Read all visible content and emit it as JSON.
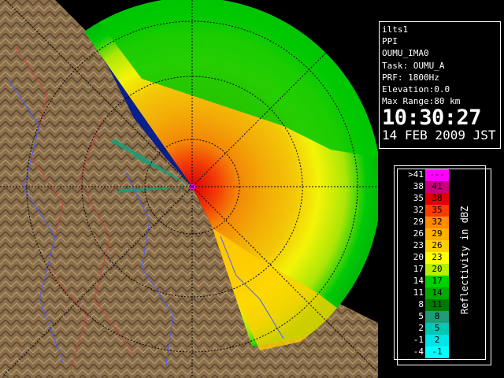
{
  "info": {
    "station": "ilts1",
    "scan_type": "PPI",
    "site": "OUMU_IMA0",
    "task": "Task: OUMU_A",
    "prf": "PRF: 1800Hz",
    "elevation": "Elevation:0.0",
    "max_range": "Max Range:80 km",
    "time": "10:30:27",
    "date": "14 FEB 2009 JST"
  },
  "legend": {
    "title": "Reflectivity in dBZ",
    "rows": [
      {
        "lo": ">41",
        "hi": "---",
        "color": "#ff00ff"
      },
      {
        "lo": "38",
        "hi": "41",
        "color": "#c8007a"
      },
      {
        "lo": "35",
        "hi": "38",
        "color": "#e00000"
      },
      {
        "lo": "32",
        "hi": "35",
        "color": "#ff3c00"
      },
      {
        "lo": "29",
        "hi": "32",
        "color": "#ff8a00"
      },
      {
        "lo": "26",
        "hi": "29",
        "color": "#ffb000"
      },
      {
        "lo": "23",
        "hi": "26",
        "color": "#ffd000"
      },
      {
        "lo": "20",
        "hi": "23",
        "color": "#ffff00"
      },
      {
        "lo": "17",
        "hi": "20",
        "color": "#b4f000"
      },
      {
        "lo": "14",
        "hi": "17",
        "color": "#00d200"
      },
      {
        "lo": "11",
        "hi": "14",
        "color": "#00aa00"
      },
      {
        "lo": "8",
        "hi": "11",
        "color": "#007a00"
      },
      {
        "lo": "5",
        "hi": "8",
        "color": "#1e9c7a"
      },
      {
        "lo": "2",
        "hi": "5",
        "color": "#00c8b4"
      },
      {
        "lo": "-1",
        "hi": "2",
        "color": "#00e6e6"
      },
      {
        "lo": "-4",
        "hi": "-1",
        "color": "#00ffff"
      }
    ]
  },
  "colors": {
    "sea": "#0a1e8c",
    "land": "#8a6f4a",
    "river": "#4a5aff",
    "border": "#c84040",
    "range_ring": "#000000"
  }
}
